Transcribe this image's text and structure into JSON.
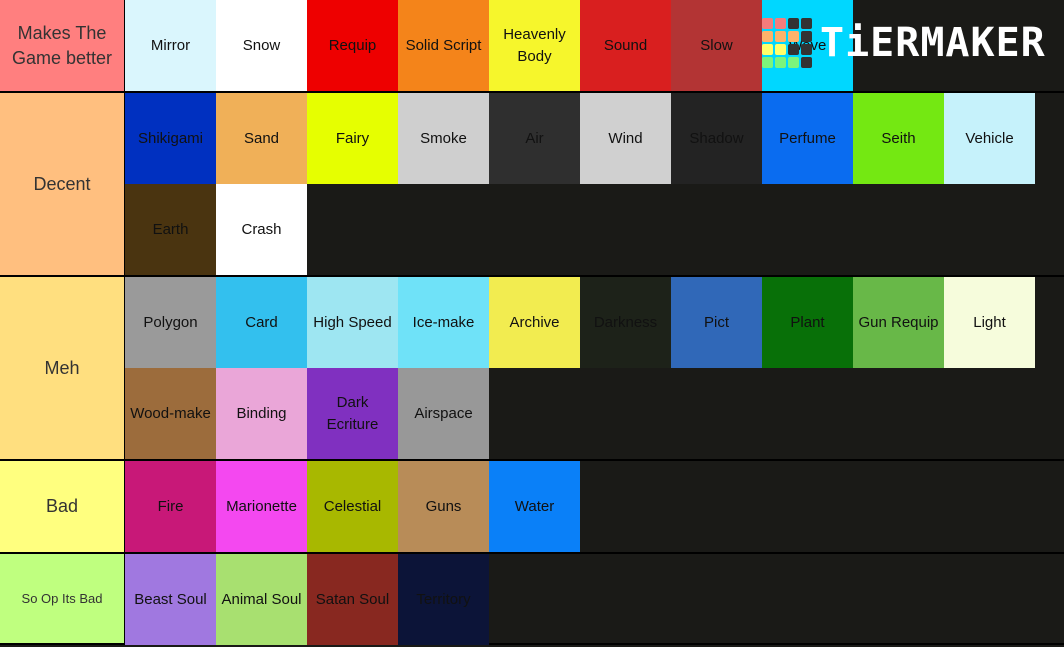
{
  "brand": {
    "name": "TiERMAKER",
    "grid_colors": [
      "#f47c7c",
      "#f47c7c",
      "#333",
      "#333",
      "#ffb36b",
      "#ffb36b",
      "#ffb36b",
      "#333",
      "#ffff6b",
      "#ffff6b",
      "#333",
      "#333",
      "#7cf47c",
      "#7cf47c",
      "#7cf47c",
      "#333"
    ]
  },
  "tiers": [
    {
      "label": "Makes The Game better",
      "color": "#ff7f7f",
      "items": [
        {
          "name": "Mirror",
          "color": "#daf6fd"
        },
        {
          "name": "Snow",
          "color": "#ffffff"
        },
        {
          "name": "Requip",
          "color": "#ee0000"
        },
        {
          "name": "Solid Script",
          "color": "#f4841a"
        },
        {
          "name": "Heavenly Body",
          "color": "#f6f62c"
        },
        {
          "name": "Sound",
          "color": "#d91f1f"
        },
        {
          "name": "Slow",
          "color": "#b33434"
        },
        {
          "name": "Wave",
          "color": "#00d7ff"
        }
      ]
    },
    {
      "label": "Decent",
      "color": "#ffbf7f",
      "items": [
        {
          "name": "Shikigami",
          "color": "#0030c0"
        },
        {
          "name": "Sand",
          "color": "#f0b058"
        },
        {
          "name": "Fairy",
          "color": "#e6ff00"
        },
        {
          "name": "Smoke",
          "color": "#cfcfcf"
        },
        {
          "name": "Air",
          "color": "#2f2f2f"
        },
        {
          "name": "Wind",
          "color": "#d0d0d0"
        },
        {
          "name": "Shadow",
          "color": "#232323"
        },
        {
          "name": "Perfume",
          "color": "#0a6cf0"
        },
        {
          "name": "Seith",
          "color": "#74e812"
        },
        {
          "name": "Vehicle",
          "color": "#c6f2fb"
        },
        {
          "name": "Earth",
          "color": "#4a3410"
        },
        {
          "name": "Crash",
          "color": "#ffffff"
        }
      ]
    },
    {
      "label": "Meh",
      "color": "#ffdf7f",
      "items": [
        {
          "name": "Polygon",
          "color": "#9a9a9a"
        },
        {
          "name": "Card",
          "color": "#33c0ee"
        },
        {
          "name": "High Speed",
          "color": "#9ee6f2"
        },
        {
          "name": "Ice-make",
          "color": "#6fe2f8"
        },
        {
          "name": "Archive",
          "color": "#f2ec50"
        },
        {
          "name": "Darkness",
          "color": "#1d2219"
        },
        {
          "name": "Pict",
          "color": "#3068b8"
        },
        {
          "name": "Plant",
          "color": "#087008"
        },
        {
          "name": "Gun Requip",
          "color": "#68b848"
        },
        {
          "name": "Light",
          "color": "#f6fcdc"
        },
        {
          "name": "Wood-make",
          "color": "#9c6c3c"
        },
        {
          "name": "Binding",
          "color": "#eaa6d8"
        },
        {
          "name": "Dark Ecriture",
          "color": "#8030c0"
        },
        {
          "name": "Airspace",
          "color": "#989898"
        }
      ]
    },
    {
      "label": "Bad",
      "color": "#ffff7f",
      "items": [
        {
          "name": "Fire",
          "color": "#c81878"
        },
        {
          "name": "Marionette",
          "color": "#f448f0"
        },
        {
          "name": "Celestial",
          "color": "#a8b800"
        },
        {
          "name": "Guns",
          "color": "#b88c58"
        },
        {
          "name": "Water",
          "color": "#0a80f8"
        }
      ]
    },
    {
      "label": "So Op Its Bad",
      "color": "#bfff7f",
      "items": [
        {
          "name": "Beast Soul",
          "color": "#a078e0"
        },
        {
          "name": "Animal Soul",
          "color": "#a8e070"
        },
        {
          "name": "Satan Soul",
          "color": "#882820"
        },
        {
          "name": "Territory",
          "color": "#0c1438"
        }
      ]
    }
  ]
}
